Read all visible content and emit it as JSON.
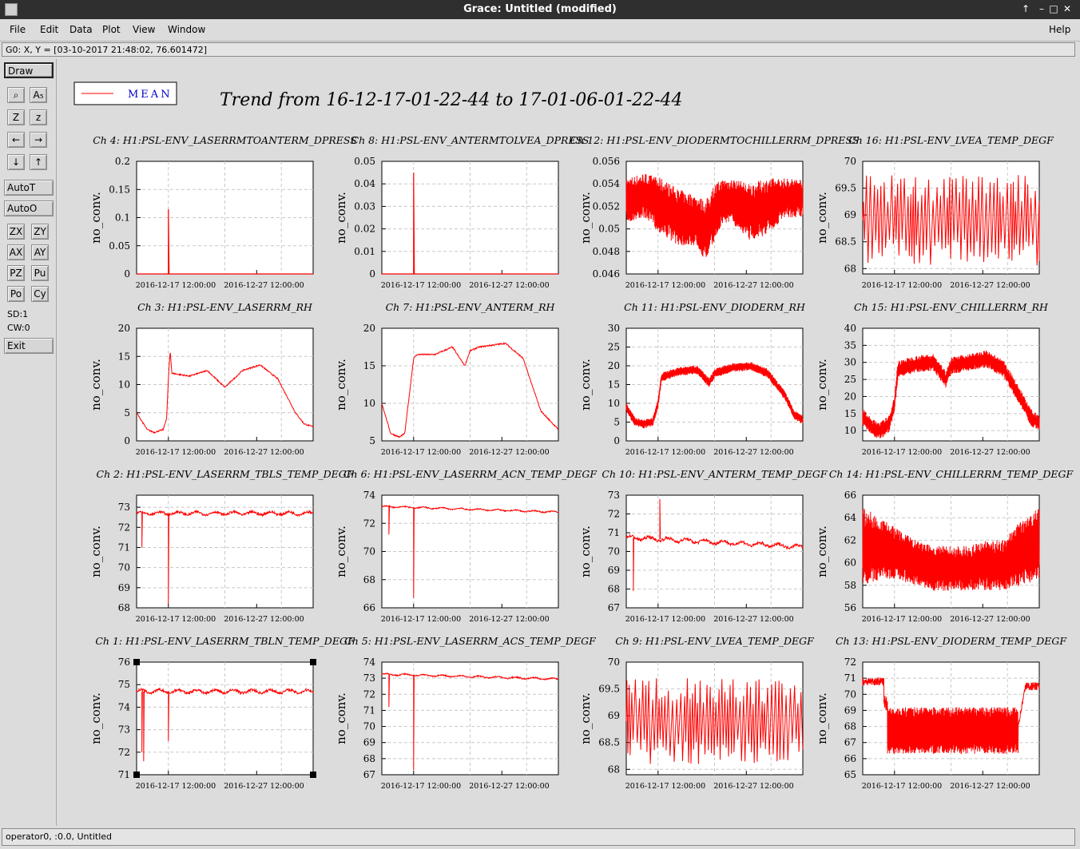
{
  "window": {
    "title": "Grace: Untitled (modified)"
  },
  "menu": {
    "items": [
      "File",
      "Edit",
      "Data",
      "Plot",
      "View",
      "Window"
    ],
    "help": "Help"
  },
  "coordinates": "G0: X, Y = [03-10-2017 21:48:02, 76.601472]",
  "toolbar": {
    "draw": "Draw",
    "zoom_row": [
      "⌕",
      "A₅"
    ],
    "z_row": [
      "Z",
      "z"
    ],
    "lr_row": [
      "←",
      "→"
    ],
    "ud_row": [
      "↓",
      "↑"
    ],
    "autot": "AutoT",
    "autoo": "AutoO",
    "pairs": [
      [
        "ZX",
        "ZY"
      ],
      [
        "AX",
        "AY"
      ],
      [
        "PZ",
        "Pu"
      ],
      [
        "Po",
        "Cy"
      ]
    ],
    "sd": "SD:1",
    "cw": "CW:0",
    "exit": "Exit"
  },
  "legend": {
    "label": "MEAN",
    "color": "#ff0000"
  },
  "plot_title": "Trend from 16-12-17-01-22-44 to 17-01-06-01-22-44",
  "status": "operator0, :0.0, Untitled",
  "chart_data": [
    {
      "type": "line",
      "title": "Ch 4: H1:PSL-ENV_LASERRMTOANTERM_DPRESS",
      "ylabel": "no_conv.",
      "yticks": [
        "0",
        "0.05",
        "0.1",
        "0.15",
        "0.2"
      ],
      "ylim": [
        0,
        0.2
      ],
      "xticks": [
        "2016-12-17 12:00:00",
        "2016-12-27 12:00:00"
      ],
      "style": "spike",
      "base": 0.0,
      "spikes": [
        [
          0.18,
          0.115
        ]
      ],
      "color": "#ff0000"
    },
    {
      "type": "line",
      "title": "Ch 8: H1:PSL-ENV_ANTERMTOLVEA_DPRESS",
      "ylabel": "no_conv.",
      "yticks": [
        "0",
        "0.01",
        "0.02",
        "0.03",
        "0.04",
        "0.05"
      ],
      "ylim": [
        0,
        0.05
      ],
      "xticks": [
        "2016-12-17 12:00:00",
        "2016-12-27 12:00:00"
      ],
      "style": "spike",
      "base": 0.0,
      "spikes": [
        [
          0.18,
          0.045
        ]
      ],
      "color": "#ff0000"
    },
    {
      "type": "line",
      "title": "Ch 12: H1:PSL-ENV_DIODERMTOCHILLERRM_DPRESS",
      "ylabel": "no_conv.",
      "yticks": [
        "0.046",
        "0.048",
        "0.05",
        "0.052",
        "0.054",
        "0.056"
      ],
      "ylim": [
        0.046,
        0.056
      ],
      "xticks": [
        "2016-12-17 12:00:00",
        "2016-12-27 12:00:00"
      ],
      "style": "band",
      "x": [
        0,
        0.1,
        0.2,
        0.3,
        0.4,
        0.45,
        0.5,
        0.55,
        0.6,
        0.7,
        0.8,
        0.9,
        1.0
      ],
      "lo": [
        0.0505,
        0.051,
        0.0495,
        0.0485,
        0.0485,
        0.047,
        0.049,
        0.0505,
        0.0505,
        0.049,
        0.0495,
        0.051,
        0.051
      ],
      "hi": [
        0.0545,
        0.055,
        0.0545,
        0.0535,
        0.053,
        0.0525,
        0.054,
        0.0545,
        0.0545,
        0.054,
        0.0545,
        0.0545,
        0.0545
      ],
      "color": "#ff0000"
    },
    {
      "type": "line",
      "title": "Ch 16: H1:PSL-ENV_LVEA_TEMP_DEGF",
      "ylabel": "no_conv.",
      "yticks": [
        "68",
        "68.5",
        "69",
        "69.5",
        "70"
      ],
      "ylim": [
        67.9,
        70
      ],
      "xticks": [
        "2016-12-17 12:00:00",
        "2016-12-27 12:00:00"
      ],
      "style": "osc",
      "osc_lo": 68.05,
      "osc_hi": 69.75,
      "color": "#ff0000"
    },
    {
      "type": "line",
      "title": "Ch 3: H1:PSL-ENV_LASERRM_RH",
      "ylabel": "no_conv.",
      "yticks": [
        "0",
        "5",
        "10",
        "15",
        "20"
      ],
      "ylim": [
        0,
        20
      ],
      "xticks": [
        "2016-12-17 12:00:00",
        "2016-12-27 12:00:00"
      ],
      "style": "line",
      "x": [
        0,
        0.06,
        0.1,
        0.15,
        0.17,
        0.18,
        0.19,
        0.2,
        0.3,
        0.4,
        0.5,
        0.6,
        0.7,
        0.74,
        0.8,
        0.9,
        0.95,
        1.0
      ],
      "y": [
        5,
        2,
        1.5,
        2,
        4,
        11,
        16,
        12,
        11.5,
        12.5,
        9.5,
        12.5,
        13.5,
        12.5,
        11,
        5,
        3,
        2.5
      ],
      "color": "#ff0000"
    },
    {
      "type": "line",
      "title": "Ch 7: H1:PSL-ENV_ANTERM_RH",
      "ylabel": "no_conv.",
      "yticks": [
        "5",
        "10",
        "15",
        "20"
      ],
      "ylim": [
        5,
        20
      ],
      "xticks": [
        "2016-12-17 12:00:00",
        "2016-12-27 12:00:00"
      ],
      "style": "line",
      "x": [
        0,
        0.05,
        0.1,
        0.13,
        0.15,
        0.18,
        0.2,
        0.3,
        0.4,
        0.47,
        0.5,
        0.55,
        0.7,
        0.8,
        0.9,
        1.0
      ],
      "y": [
        10,
        6,
        5.5,
        6,
        10,
        16,
        16.5,
        16.5,
        17.5,
        15,
        17,
        17.5,
        18,
        16,
        9,
        6.5
      ],
      "color": "#ff0000"
    },
    {
      "type": "line",
      "title": "Ch 11: H1:PSL-ENV_DIODERM_RH",
      "ylabel": "no_conv.",
      "yticks": [
        "0",
        "5",
        "10",
        "15",
        "20",
        "25",
        "30"
      ],
      "ylim": [
        0,
        30
      ],
      "xticks": [
        "2016-12-17 12:00:00",
        "2016-12-27 12:00:00"
      ],
      "style": "bandline",
      "x": [
        0,
        0.05,
        0.1,
        0.15,
        0.18,
        0.2,
        0.3,
        0.4,
        0.47,
        0.5,
        0.6,
        0.7,
        0.8,
        0.9,
        0.95,
        1.0
      ],
      "y": [
        9,
        5,
        4.5,
        5,
        10,
        17,
        18.5,
        19,
        15.5,
        18,
        19.5,
        20,
        18,
        12,
        7,
        5.5
      ],
      "w": 1.2,
      "color": "#ff0000"
    },
    {
      "type": "line",
      "title": "Ch 15: H1:PSL-ENV_CHILLERRM_RH",
      "ylabel": "no_conv.",
      "yticks": [
        "10",
        "15",
        "20",
        "25",
        "30",
        "35",
        "40"
      ],
      "ylim": [
        7,
        40
      ],
      "xticks": [
        "2016-12-17 12:00:00",
        "2016-12-27 12:00:00"
      ],
      "style": "bandline",
      "x": [
        0,
        0.05,
        0.1,
        0.15,
        0.18,
        0.2,
        0.3,
        0.4,
        0.47,
        0.5,
        0.6,
        0.7,
        0.8,
        0.9,
        0.95,
        1.0
      ],
      "y": [
        14,
        11,
        10,
        12,
        18,
        28,
        29.5,
        30,
        25,
        29,
        30,
        31,
        28,
        19,
        14,
        12
      ],
      "w": 2.5,
      "color": "#ff0000"
    },
    {
      "type": "line",
      "title": "Ch 2: H1:PSL-ENV_LASERRM_TBLS_TEMP_DEGF",
      "ylabel": "no_conv.",
      "yticks": [
        "68",
        "69",
        "70",
        "71",
        "72",
        "73"
      ],
      "ylim": [
        68,
        73.6
      ],
      "xticks": [
        "2016-12-17 12:00:00",
        "2016-12-27 12:00:00"
      ],
      "style": "flat",
      "level": 72.7,
      "noise": 0.12,
      "spikes": [
        [
          0.03,
          71
        ],
        [
          0.18,
          68.2
        ]
      ],
      "color": "#ff0000"
    },
    {
      "type": "line",
      "title": "Ch 6: H1:PSL-ENV_LASERRM_ACN_TEMP_DEGF",
      "ylabel": "no_conv.",
      "yticks": [
        "66",
        "68",
        "70",
        "72",
        "74"
      ],
      "ylim": [
        66,
        74
      ],
      "xticks": [
        "2016-12-17 12:00:00",
        "2016-12-27 12:00:00"
      ],
      "style": "flat",
      "level": 73.2,
      "slope": -0.4,
      "noise": 0.08,
      "spikes": [
        [
          0.04,
          71.2
        ],
        [
          0.18,
          66.7
        ]
      ],
      "color": "#ff0000"
    },
    {
      "type": "line",
      "title": "Ch 10: H1:PSL-ENV_ANTERM_TEMP_DEGF",
      "ylabel": "no_conv.",
      "yticks": [
        "67",
        "68",
        "69",
        "70",
        "71",
        "72",
        "73"
      ],
      "ylim": [
        67,
        73
      ],
      "xticks": [
        "2016-12-17 12:00:00",
        "2016-12-27 12:00:00"
      ],
      "style": "flat",
      "level": 70.75,
      "slope": -0.5,
      "noise": 0.15,
      "spikes": [
        [
          0.04,
          67.9
        ],
        [
          0.19,
          72.8
        ]
      ],
      "color": "#ff0000"
    },
    {
      "type": "line",
      "title": "Ch 14: H1:PSL-ENV_CHILLERRM_TEMP_DEGF",
      "ylabel": "no_conv.",
      "yticks": [
        "56",
        "58",
        "60",
        "62",
        "64",
        "66"
      ],
      "ylim": [
        56,
        66
      ],
      "xticks": [
        "2016-12-17 12:00:00",
        "2016-12-27 12:00:00"
      ],
      "style": "band",
      "x": [
        0,
        0.1,
        0.2,
        0.3,
        0.4,
        0.5,
        0.6,
        0.7,
        0.8,
        0.9,
        1.0
      ],
      "lo": [
        58,
        58.5,
        58.5,
        58,
        57.5,
        57.5,
        57.5,
        57.5,
        57.5,
        58,
        58.5
      ],
      "hi": [
        65,
        64,
        63,
        62,
        61.5,
        61.5,
        61.5,
        62,
        62,
        64,
        65
      ],
      "color": "#ff0000"
    },
    {
      "type": "line",
      "title": "Ch 1: H1:PSL-ENV_LASERRM_TBLN_TEMP_DEGF",
      "ylabel": "no_conv.",
      "yticks": [
        "71",
        "72",
        "73",
        "74",
        "75",
        "76"
      ],
      "ylim": [
        71,
        76
      ],
      "xticks": [
        "2016-12-17 12:00:00",
        "2016-12-27 12:00:00"
      ],
      "style": "flat",
      "level": 74.7,
      "noise": 0.12,
      "spikes": [
        [
          0.03,
          72
        ],
        [
          0.04,
          71.6
        ],
        [
          0.18,
          72.5
        ]
      ],
      "color": "#ff0000"
    },
    {
      "type": "line",
      "title": "Ch 5: H1:PSL-ENV_LASERRM_ACS_TEMP_DEGF",
      "ylabel": "no_conv.",
      "yticks": [
        "67",
        "68",
        "69",
        "70",
        "71",
        "72",
        "73",
        "74"
      ],
      "ylim": [
        67,
        74
      ],
      "xticks": [
        "2016-12-17 12:00:00",
        "2016-12-27 12:00:00"
      ],
      "style": "flat",
      "level": 73.25,
      "slope": -0.3,
      "noise": 0.08,
      "spikes": [
        [
          0.04,
          71.2
        ],
        [
          0.18,
          67.3
        ]
      ],
      "color": "#ff0000"
    },
    {
      "type": "line",
      "title": "Ch 9: H1:PSL-ENV_LVEA_TEMP_DEGF",
      "ylabel": "no_conv.",
      "yticks": [
        "68",
        "68.5",
        "69",
        "69.5",
        "70"
      ],
      "ylim": [
        67.9,
        70
      ],
      "xticks": [
        "2016-12-17 12:00:00",
        "2016-12-27 12:00:00"
      ],
      "style": "osc",
      "osc_lo": 68.1,
      "osc_hi": 69.7,
      "color": "#ff0000"
    },
    {
      "type": "line",
      "title": "Ch 13: H1:PSL-ENV_DIODERM_TEMP_DEGF",
      "ylabel": "no_conv.",
      "yticks": [
        "65",
        "66",
        "67",
        "68",
        "69",
        "70",
        "71",
        "72"
      ],
      "ylim": [
        65,
        72
      ],
      "xticks": [
        "2016-12-17 12:00:00",
        "2016-12-27 12:00:00"
      ],
      "style": "regime",
      "color": "#ff0000"
    }
  ]
}
